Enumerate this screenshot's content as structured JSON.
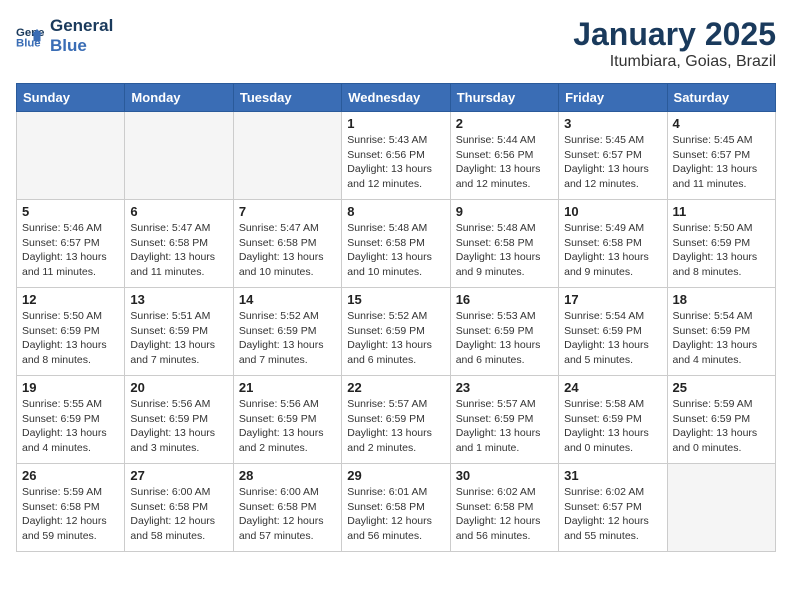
{
  "header": {
    "logo_line1": "General",
    "logo_line2": "Blue",
    "month": "January 2025",
    "location": "Itumbiara, Goias, Brazil"
  },
  "weekdays": [
    "Sunday",
    "Monday",
    "Tuesday",
    "Wednesday",
    "Thursday",
    "Friday",
    "Saturday"
  ],
  "weeks": [
    [
      {
        "day": "",
        "info": ""
      },
      {
        "day": "",
        "info": ""
      },
      {
        "day": "",
        "info": ""
      },
      {
        "day": "1",
        "info": "Sunrise: 5:43 AM\nSunset: 6:56 PM\nDaylight: 13 hours and 12 minutes."
      },
      {
        "day": "2",
        "info": "Sunrise: 5:44 AM\nSunset: 6:56 PM\nDaylight: 13 hours and 12 minutes."
      },
      {
        "day": "3",
        "info": "Sunrise: 5:45 AM\nSunset: 6:57 PM\nDaylight: 13 hours and 12 minutes."
      },
      {
        "day": "4",
        "info": "Sunrise: 5:45 AM\nSunset: 6:57 PM\nDaylight: 13 hours and 11 minutes."
      }
    ],
    [
      {
        "day": "5",
        "info": "Sunrise: 5:46 AM\nSunset: 6:57 PM\nDaylight: 13 hours and 11 minutes."
      },
      {
        "day": "6",
        "info": "Sunrise: 5:47 AM\nSunset: 6:58 PM\nDaylight: 13 hours and 11 minutes."
      },
      {
        "day": "7",
        "info": "Sunrise: 5:47 AM\nSunset: 6:58 PM\nDaylight: 13 hours and 10 minutes."
      },
      {
        "day": "8",
        "info": "Sunrise: 5:48 AM\nSunset: 6:58 PM\nDaylight: 13 hours and 10 minutes."
      },
      {
        "day": "9",
        "info": "Sunrise: 5:48 AM\nSunset: 6:58 PM\nDaylight: 13 hours and 9 minutes."
      },
      {
        "day": "10",
        "info": "Sunrise: 5:49 AM\nSunset: 6:58 PM\nDaylight: 13 hours and 9 minutes."
      },
      {
        "day": "11",
        "info": "Sunrise: 5:50 AM\nSunset: 6:59 PM\nDaylight: 13 hours and 8 minutes."
      }
    ],
    [
      {
        "day": "12",
        "info": "Sunrise: 5:50 AM\nSunset: 6:59 PM\nDaylight: 13 hours and 8 minutes."
      },
      {
        "day": "13",
        "info": "Sunrise: 5:51 AM\nSunset: 6:59 PM\nDaylight: 13 hours and 7 minutes."
      },
      {
        "day": "14",
        "info": "Sunrise: 5:52 AM\nSunset: 6:59 PM\nDaylight: 13 hours and 7 minutes."
      },
      {
        "day": "15",
        "info": "Sunrise: 5:52 AM\nSunset: 6:59 PM\nDaylight: 13 hours and 6 minutes."
      },
      {
        "day": "16",
        "info": "Sunrise: 5:53 AM\nSunset: 6:59 PM\nDaylight: 13 hours and 6 minutes."
      },
      {
        "day": "17",
        "info": "Sunrise: 5:54 AM\nSunset: 6:59 PM\nDaylight: 13 hours and 5 minutes."
      },
      {
        "day": "18",
        "info": "Sunrise: 5:54 AM\nSunset: 6:59 PM\nDaylight: 13 hours and 4 minutes."
      }
    ],
    [
      {
        "day": "19",
        "info": "Sunrise: 5:55 AM\nSunset: 6:59 PM\nDaylight: 13 hours and 4 minutes."
      },
      {
        "day": "20",
        "info": "Sunrise: 5:56 AM\nSunset: 6:59 PM\nDaylight: 13 hours and 3 minutes."
      },
      {
        "day": "21",
        "info": "Sunrise: 5:56 AM\nSunset: 6:59 PM\nDaylight: 13 hours and 2 minutes."
      },
      {
        "day": "22",
        "info": "Sunrise: 5:57 AM\nSunset: 6:59 PM\nDaylight: 13 hours and 2 minutes."
      },
      {
        "day": "23",
        "info": "Sunrise: 5:57 AM\nSunset: 6:59 PM\nDaylight: 13 hours and 1 minute."
      },
      {
        "day": "24",
        "info": "Sunrise: 5:58 AM\nSunset: 6:59 PM\nDaylight: 13 hours and 0 minutes."
      },
      {
        "day": "25",
        "info": "Sunrise: 5:59 AM\nSunset: 6:59 PM\nDaylight: 13 hours and 0 minutes."
      }
    ],
    [
      {
        "day": "26",
        "info": "Sunrise: 5:59 AM\nSunset: 6:58 PM\nDaylight: 12 hours and 59 minutes."
      },
      {
        "day": "27",
        "info": "Sunrise: 6:00 AM\nSunset: 6:58 PM\nDaylight: 12 hours and 58 minutes."
      },
      {
        "day": "28",
        "info": "Sunrise: 6:00 AM\nSunset: 6:58 PM\nDaylight: 12 hours and 57 minutes."
      },
      {
        "day": "29",
        "info": "Sunrise: 6:01 AM\nSunset: 6:58 PM\nDaylight: 12 hours and 56 minutes."
      },
      {
        "day": "30",
        "info": "Sunrise: 6:02 AM\nSunset: 6:58 PM\nDaylight: 12 hours and 56 minutes."
      },
      {
        "day": "31",
        "info": "Sunrise: 6:02 AM\nSunset: 6:57 PM\nDaylight: 12 hours and 55 minutes."
      },
      {
        "day": "",
        "info": ""
      }
    ]
  ]
}
